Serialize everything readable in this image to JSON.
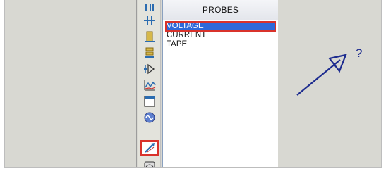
{
  "panel": {
    "title": "PROBES",
    "items": [
      "VOLTAGE",
      "CURRENT",
      "TAPE"
    ],
    "selected_index": 0
  },
  "toolbar": {
    "tools": [
      "terminal-icon",
      "pin-icon",
      "component-icon",
      "subcircuit-icon",
      "device-pin-icon",
      "graph-icon",
      "window-icon",
      "generator-icon",
      "probe-icon",
      "virtual-instrument-icon"
    ],
    "highlighted_tool": "probe-icon"
  },
  "canvas": {
    "annotation": "?"
  },
  "colors": {
    "selection": "#2f69d9",
    "highlight_outline": "#d9322b",
    "arrow": "#1d2c8f",
    "background": "#d8d8d2"
  }
}
